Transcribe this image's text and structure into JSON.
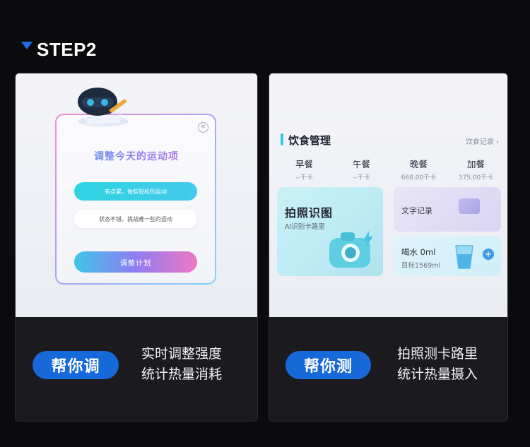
{
  "header": {
    "step": "STEP2"
  },
  "left_card": {
    "dialog": {
      "title": "调整今天的运动项",
      "option1": "有点累，做些轻松的运动",
      "option2": "状态不错，挑战难一些的运动",
      "button": "调整计划",
      "close_icon": "close-icon"
    },
    "badge": "帮你调",
    "desc_line1": "实时调整强度",
    "desc_line2": "统计热量消耗"
  },
  "right_card": {
    "diet": {
      "title": "饮食管理",
      "record_link": "饮食记录 ›",
      "meals": [
        {
          "name": "早餐",
          "kcal": "--千卡"
        },
        {
          "name": "午餐",
          "kcal": "--千卡"
        },
        {
          "name": "晚餐",
          "kcal": "668.00千卡"
        },
        {
          "name": "加餐",
          "kcal": "375.00千卡"
        }
      ],
      "photo_title": "拍照识图",
      "photo_sub": "AI识别卡路里",
      "text_record": "文字记录",
      "water_title": "喝水 0ml",
      "water_target": "目标1569ml",
      "plus": "+"
    },
    "badge": "帮你测",
    "desc_line1": "拍照测卡路里",
    "desc_line2": "统计热量摄入"
  },
  "colors": {
    "accent_blue": "#1768d9",
    "cyan": "#32c9e3",
    "pink": "#ef78c6"
  }
}
